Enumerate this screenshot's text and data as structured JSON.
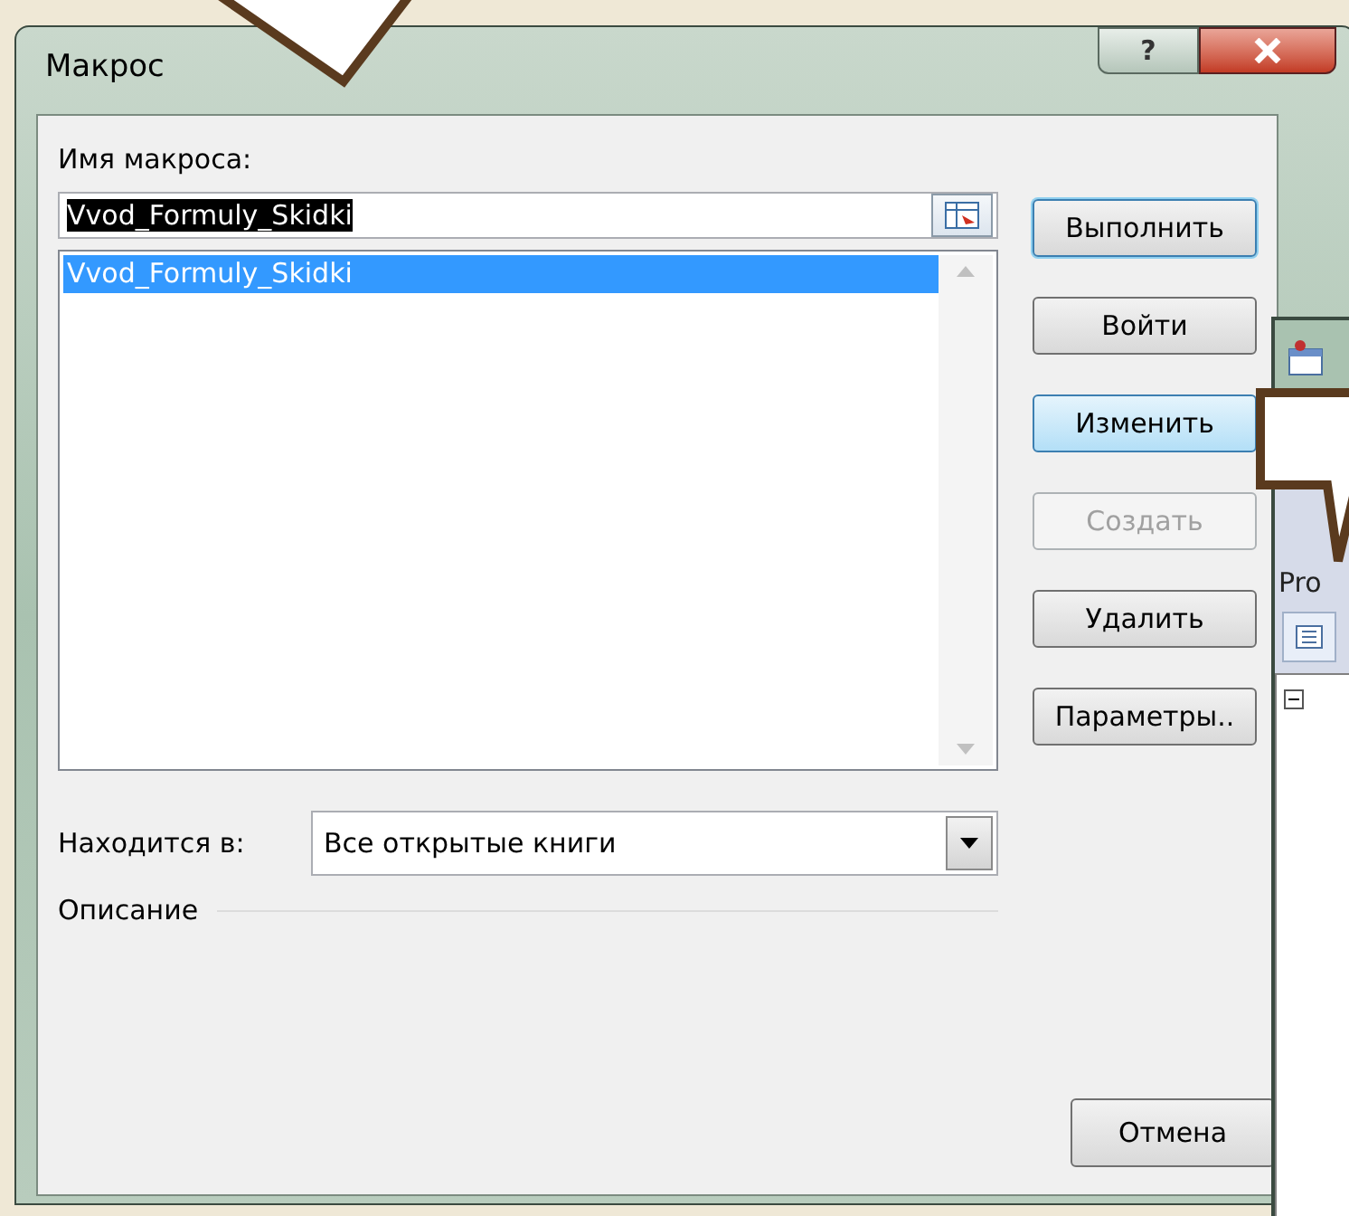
{
  "dialog": {
    "title": "Макрос",
    "help_button": {
      "label": "?"
    }
  },
  "macro_name": {
    "label": "Имя макроса:",
    "value": "Vvod_Formuly_Skidki",
    "highlighted": true
  },
  "macro_list": {
    "items": [
      {
        "label": "Vvod_Formuly_Skidki",
        "selected": true
      }
    ]
  },
  "buttons": [
    {
      "label": "Выполнить",
      "focused": true,
      "hovered": false,
      "disabled": false
    },
    {
      "label": "Войти",
      "focused": false,
      "hovered": false,
      "disabled": false
    },
    {
      "label": "Изменить",
      "focused": false,
      "hovered": true,
      "disabled": false
    },
    {
      "label": "Создать",
      "focused": false,
      "hovered": false,
      "disabled": true
    },
    {
      "label": "Удалить",
      "focused": false,
      "hovered": false,
      "disabled": false
    },
    {
      "label": "Параметры..",
      "focused": false,
      "hovered": false,
      "disabled": false
    }
  ],
  "location": {
    "label": "Находится в:",
    "value": "Все открытые книги"
  },
  "description": {
    "label": "Описание"
  },
  "cancel_button": {
    "label": "Отмена"
  },
  "vba_window": {
    "label": "Pro"
  }
}
